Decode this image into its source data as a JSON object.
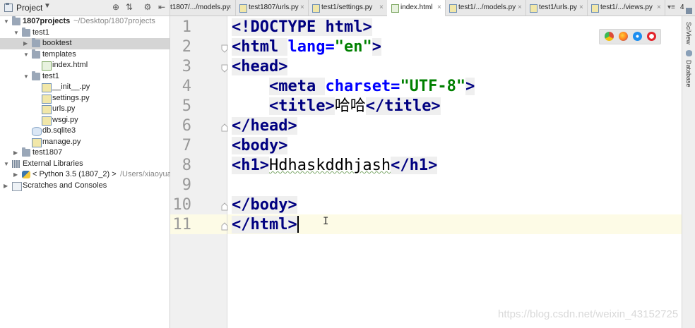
{
  "project_panel": {
    "title": "Project",
    "tree": [
      {
        "label": "1807projects",
        "sub": "~/Desktop/1807projects"
      },
      {
        "label": "test1"
      },
      {
        "label": "booktest"
      },
      {
        "label": "templates"
      },
      {
        "label": "index.html"
      },
      {
        "label": "test1"
      },
      {
        "label": "__init__.py"
      },
      {
        "label": "settings.py"
      },
      {
        "label": "urls.py"
      },
      {
        "label": "wsgi.py"
      },
      {
        "label": "db.sqlite3"
      },
      {
        "label": "manage.py"
      },
      {
        "label": "test1807"
      },
      {
        "label": "External Libraries"
      },
      {
        "label": "< Python 3.5 (1807_2) >",
        "sub": "/Users/xiaoyuan"
      },
      {
        "label": "Scratches and Consoles"
      }
    ]
  },
  "tabs": [
    {
      "label": "t1807/.../models.py"
    },
    {
      "label": "test1807/urls.py"
    },
    {
      "label": "test1/settings.py"
    },
    {
      "label": "index.html"
    },
    {
      "label": "test1/.../models.py"
    },
    {
      "label": "test1/urls.py"
    },
    {
      "label": "test1/.../views.py"
    },
    {
      "label": "4"
    }
  ],
  "editor": {
    "line_numbers": [
      "1",
      "2",
      "3",
      "4",
      "5",
      "6",
      "7",
      "8",
      "9",
      "10",
      "11"
    ],
    "lines": [
      {
        "parts": [
          {
            "t": "<!DOCTYPE ",
            "c": "tag"
          },
          {
            "t": "html",
            "c": "tag"
          },
          {
            "t": ">",
            "c": "tag"
          }
        ]
      },
      {
        "parts": [
          {
            "t": "<html ",
            "c": "tag"
          },
          {
            "t": "lang=",
            "c": "attr"
          },
          {
            "t": "\"en\"",
            "c": "str"
          },
          {
            "t": ">",
            "c": "tag"
          }
        ]
      },
      {
        "parts": [
          {
            "t": "<head>",
            "c": "tag"
          }
        ]
      },
      {
        "parts": [
          {
            "t": "    ",
            "c": "txt"
          },
          {
            "t": "<meta ",
            "c": "tag"
          },
          {
            "t": "charset=",
            "c": "attr"
          },
          {
            "t": "\"UTF-8\"",
            "c": "str"
          },
          {
            "t": ">",
            "c": "tag"
          }
        ]
      },
      {
        "parts": [
          {
            "t": "    ",
            "c": "txt"
          },
          {
            "t": "<title>",
            "c": "tag"
          },
          {
            "t": "哈哈",
            "c": "txt"
          },
          {
            "t": "</title>",
            "c": "tag"
          }
        ]
      },
      {
        "parts": [
          {
            "t": "</head>",
            "c": "tag"
          }
        ]
      },
      {
        "parts": [
          {
            "t": "<body>",
            "c": "tag"
          }
        ]
      },
      {
        "parts": [
          {
            "t": "<h1>",
            "c": "tag"
          },
          {
            "t": "Hdhaskddhjash",
            "c": "txt"
          },
          {
            "t": "</h1>",
            "c": "tag"
          }
        ]
      },
      {
        "parts": []
      },
      {
        "parts": [
          {
            "t": "</body>",
            "c": "tag"
          }
        ]
      },
      {
        "parts": [
          {
            "t": "</html>",
            "c": "tag"
          }
        ]
      }
    ]
  },
  "right_strip": {
    "sciview": "SciView",
    "database": "Database"
  },
  "watermark": "https://blog.csdn.net/weixin_43152725"
}
